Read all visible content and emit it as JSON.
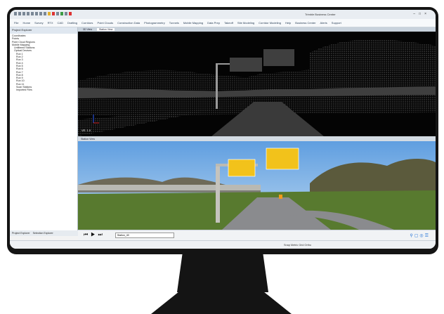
{
  "app": {
    "window_title": "Trimble Business Center",
    "ribbon_tabs": [
      "File",
      "Home",
      "Survey",
      "RTX",
      "CAD",
      "Drafting",
      "Corridors",
      "Point Clouds",
      "Construction Data",
      "Photogrammetry",
      "Tunnels",
      "Mobile Mapping",
      "Data Prep",
      "Takeoff",
      "Site Modeling",
      "Corridor Modeling",
      "Help",
      "Business Center",
      "Alerts",
      "Support"
    ]
  },
  "left_panel": {
    "title": "Project Explorer",
    "tree": [
      "Coordinates",
      "Points",
      "Point Cloud Regions",
      "Mobile Mapping",
      "Unfiltered Stations",
      "Optical Devices",
      "Run 1",
      "Run 2",
      "Run 3",
      "Run 4",
      "Run 5",
      "Run 6",
      "Run 7",
      "Run 8",
      "Run 9",
      "Run 10",
      "Run 11",
      "Scan Stations",
      "Imported Files"
    ],
    "bottom_tabs": [
      "Project Explorer",
      "Selection Explorer"
    ]
  },
  "views": {
    "top_tabs": [
      "3D View",
      "Station View"
    ],
    "photo_view_title": "Station View",
    "vertical_exaggeration": "VE: 1.0"
  },
  "player": {
    "controls": [
      "previous-frame",
      "play",
      "next-frame"
    ],
    "station_select": "Station_49"
  },
  "status_bar": {
    "text": "Snap  Metric Grid  Ortho"
  },
  "colors": {
    "sign_yellow": "#f2c21b",
    "sky": "#8fb9e6",
    "grass": "#587a2f"
  }
}
